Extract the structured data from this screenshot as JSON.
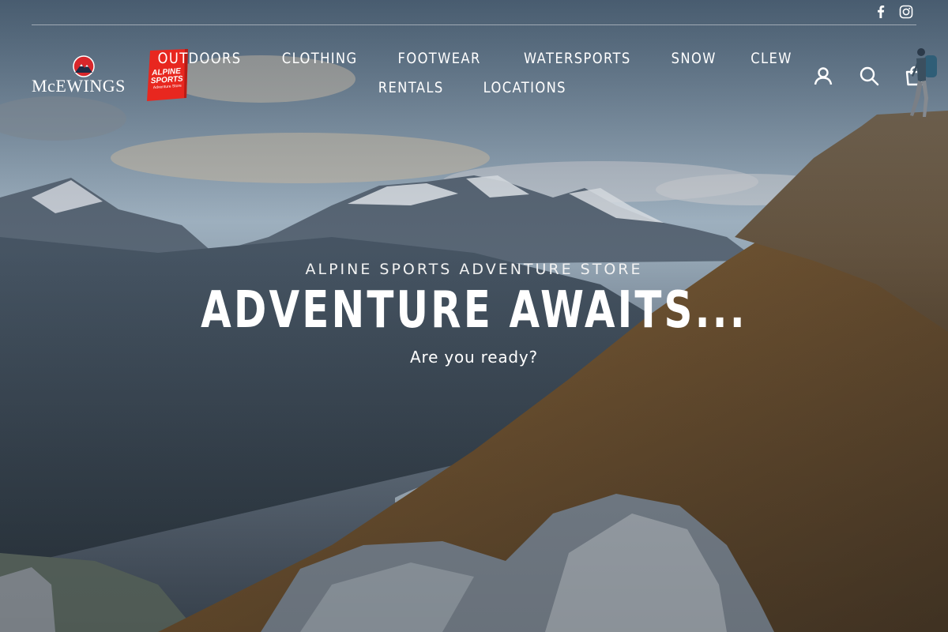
{
  "social": {
    "facebook_icon": "facebook-icon",
    "instagram_icon": "instagram-icon"
  },
  "logos": {
    "mcewings_text": "McEWINGS",
    "alpine_line1": "ALPINE",
    "alpine_line2": "SPORTS",
    "alpine_line3": "Adventure Store",
    "alpine_color": "#e8271f"
  },
  "nav": {
    "row1": [
      "OUTDOORS",
      "CLOTHING",
      "FOOTWEAR",
      "WATERSPORTS",
      "SNOW",
      "CLEW"
    ],
    "row2": [
      "RENTALS",
      "LOCATIONS"
    ]
  },
  "utility": {
    "login_icon": "user-icon",
    "search_icon": "search-icon",
    "cart_icon": "cart-icon"
  },
  "hero": {
    "eyebrow": "ALPINE SPORTS ADVENTURE STORE",
    "headline": "ADVENTURE AWAITS...",
    "subline": "Are you ready?"
  }
}
